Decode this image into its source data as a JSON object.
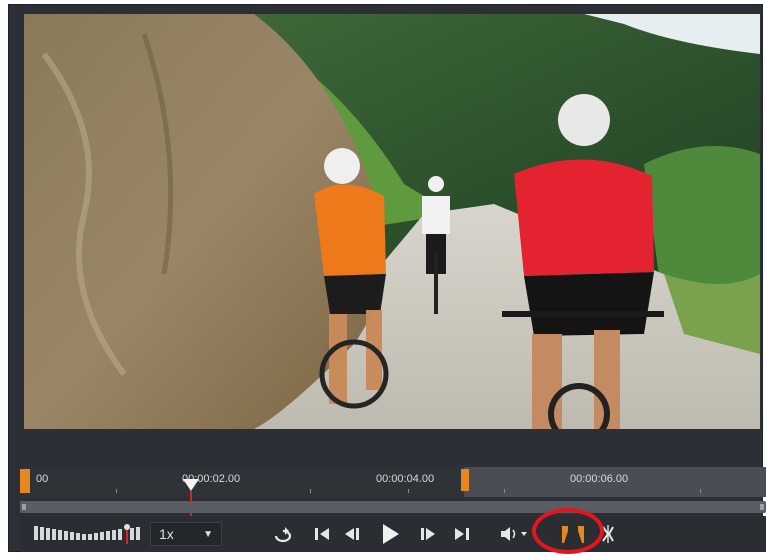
{
  "timeline": {
    "labels": [
      "00",
      "00:00:02.00",
      "00:00:04.00",
      "00:00:06.00"
    ]
  },
  "controls": {
    "speed_value": "1x",
    "speed_arrow": "▼"
  },
  "icons": {
    "loop": "loop-icon",
    "go_start": "go-to-start-icon",
    "prev_frame": "previous-frame-icon",
    "play": "play-icon",
    "next_frame": "next-frame-icon",
    "go_end": "go-to-end-icon",
    "volume": "volume-icon",
    "mark_in_out": "mark-in-out-icon",
    "split": "split-icon"
  },
  "colors": {
    "accent_orange": "#e7871f",
    "playhead_red": "#e02020",
    "highlight_red": "#e8141b"
  }
}
